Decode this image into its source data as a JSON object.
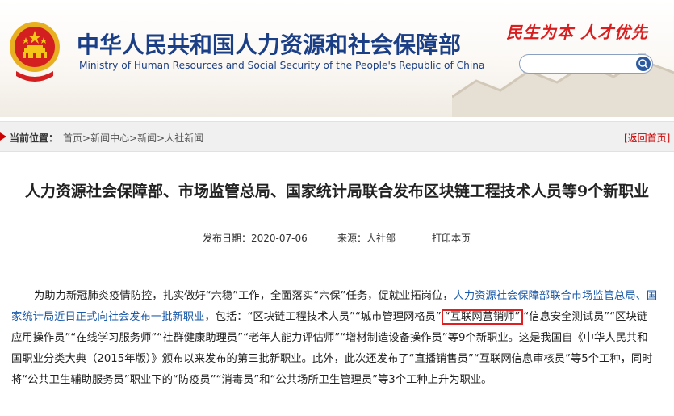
{
  "header": {
    "title_cn": "中华人民共和国人力资源和社会保障部",
    "title_en": "Ministry of Human Resources and Social Security of the People's Republic of China",
    "slogan": "民生为本 人才优先",
    "search": {
      "placeholder": "",
      "icon": "search-icon"
    }
  },
  "breadcrumb": {
    "label": "当前位置：",
    "items": [
      "首页",
      "新闻中心",
      "新闻",
      "人社新闻"
    ],
    "separator": ">",
    "back_home": "[返回首页]"
  },
  "article": {
    "title": "人力资源社会保障部、市场监管总局、国家统计局联合发布区块链工程技术人员等9个新职业",
    "publish_date": "发布日期：2020-07-06",
    "source": "来源：人社部",
    "print": "打印本页",
    "paragraph": {
      "p1": "为助力新冠肺炎疫情防控，扎实做好“六稳”工作，全面落实“六保”任务，促就业拓岗位，",
      "link": "人力资源社会保障部联合市场监管总局、国家统计局近日正式向社会发布一批新职业",
      "p2": "，包括：“区块链工程技术人员”“城市管理网格员”",
      "highlight": "“互联网营销师”",
      "p3": "“信息安全测试员”“区块链应用操作员”“在线学习服务师”“社群健康助理员”“老年人能力评估师”“增材制造设备操作员”等9个新职业。这是我国自《中华人民共和国职业分类大典（2015年版）》颁布以来发布的第三批新职业。此外，此次还发布了“直播销售员”“互联网信息审核员”等5个工种，同时将“公共卫生辅助服务员”职业下的“防疫员”“消毒员”和“公共场所卫生管理员”等3个工种上升为职业。"
    }
  },
  "colors": {
    "title_blue": "#1b3f86",
    "slogan_red": "#d81e1e",
    "link_blue": "#1a5aaa",
    "highlight_red": "#e02020"
  }
}
